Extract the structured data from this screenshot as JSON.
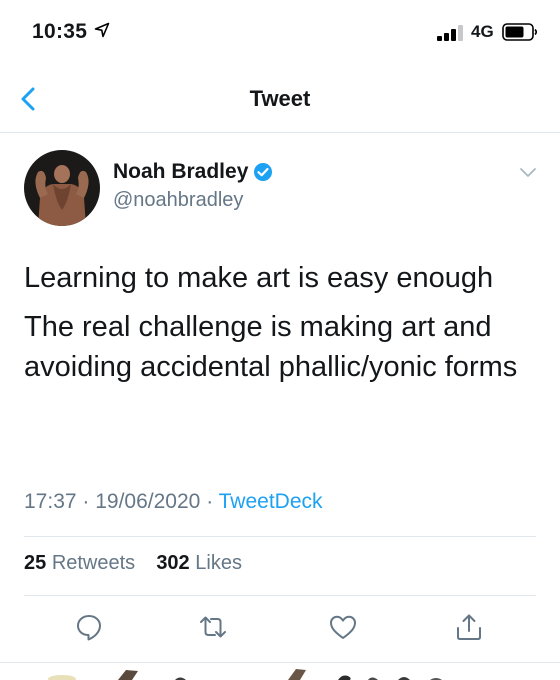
{
  "status_bar": {
    "time": "10:35",
    "network": "4G",
    "icons": [
      "location-arrow-icon",
      "signal-bars-icon",
      "battery-icon"
    ]
  },
  "nav": {
    "title": "Tweet",
    "back_icon": "chevron-left-icon"
  },
  "tweet": {
    "author": {
      "display_name": "Noah Bradley",
      "handle": "@noahbradley",
      "verified": true
    },
    "paragraphs": [
      "Learning to make art is easy enough",
      "The real challenge is making art and avoiding accidental phallic/yonic forms"
    ],
    "time": "17:37",
    "date": "19/06/2020",
    "source": "TweetDeck",
    "retweets": {
      "count": "25",
      "label": "Retweets"
    },
    "likes": {
      "count": "302",
      "label": "Likes"
    }
  },
  "actions": [
    "reply-icon",
    "retweet-icon",
    "like-icon",
    "share-icon"
  ],
  "colors": {
    "accent": "#1da1f2",
    "text": "#14171a",
    "secondary": "#657786",
    "divider": "#e1e8ed"
  }
}
